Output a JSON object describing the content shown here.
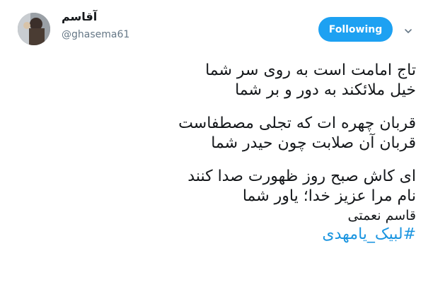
{
  "user": {
    "display_name": "آقاسم",
    "handle": "@ghasema61"
  },
  "follow_button": {
    "label": "Following"
  },
  "menu": {
    "icon": "chevron-down-icon"
  },
  "tweet": {
    "stanza1": [
      "تاج امامت است به روی سر شما",
      "خیل ملائکند به دور و بر شما"
    ],
    "stanza2": [
      "قربان چهره ات که تجلی مصطفاست",
      "قربان آن صلابت چون حیدر شما"
    ],
    "stanza3": [
      "ای کاش صبح روز ظهورت صدا کنند",
      "نام مرا عزیز خدا؛ یاور شما"
    ],
    "signature": "قاسم نعمتی",
    "hashtag": "#لبیک_یامهدی"
  },
  "colors": {
    "accent": "#1da1f2",
    "hashtag": "#1b95e0",
    "secondary_text": "#657786"
  }
}
